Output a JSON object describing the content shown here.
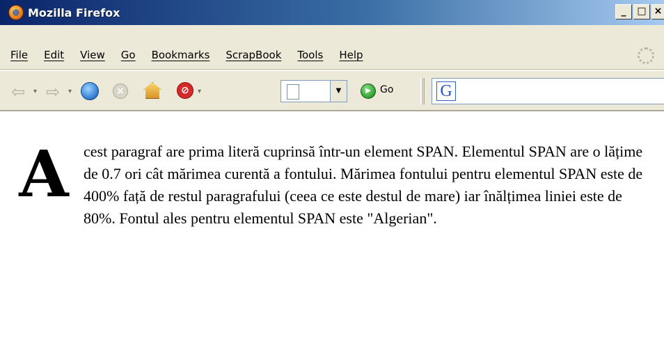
{
  "window": {
    "title": "Mozilla Firefox",
    "controls": {
      "minimize": "_",
      "maximize": "□",
      "close": "×"
    }
  },
  "menu": {
    "items": [
      "File",
      "Edit",
      "View",
      "Go",
      "Bookmarks",
      "ScrapBook",
      "Tools",
      "Help"
    ]
  },
  "toolbar": {
    "icons": [
      "back-icon",
      "forward-icon",
      "reload-icon",
      "stop-icon",
      "home-icon",
      "popup-block-icon",
      "page-icon",
      "go-icon",
      "google-icon"
    ],
    "go_label": "Go",
    "search_engine_letter": "G"
  },
  "content": {
    "dropcap": "A",
    "text": "cest paragraf are prima literă cuprinsă într-un element SPAN. Elementul SPAN are o lățime de 0.7 ori cât mărimea curentă a fontului. Mărimea fontului pentru elementul SPAN este de 400% față de restul paragrafului (ceea ce este destul de mare) iar înălțimea liniei este de 80%. Fontul ales pentru elementul SPAN este \"Algerian\"."
  }
}
